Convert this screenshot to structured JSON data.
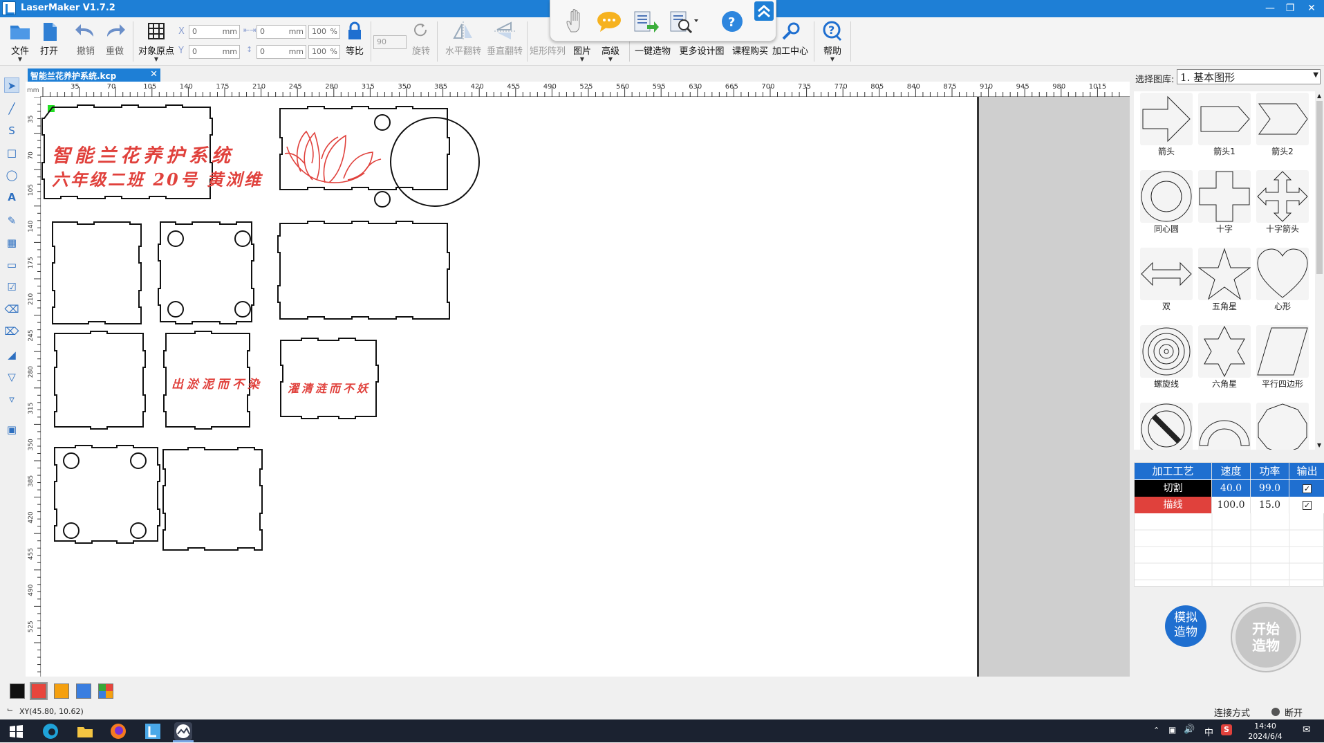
{
  "window": {
    "title": "LaserMaker V1.7.2"
  },
  "toolbar": {
    "file": "文件",
    "open": "打开",
    "undo": "撤销",
    "redo": "重做",
    "origin": "对象原点",
    "x_label": "X",
    "y_label": "Y",
    "x_value": "0",
    "y_value": "0",
    "w_value": "0",
    "h_value": "0",
    "unit_mm": "mm",
    "w_scale": "100",
    "h_scale": "100",
    "pct": "%",
    "proportional": "等比",
    "angle_value": "90",
    "rotate": "旋转",
    "flip_h": "水平翻转",
    "flip_v": "垂直翻转",
    "rect_array": "矩形阵列",
    "image": "图片",
    "advanced": "高级",
    "one_click": "一键造物",
    "more_designs": "更多设计图",
    "course_buy": "课程购买",
    "processing_center": "加工中心",
    "help": "帮助"
  },
  "document": {
    "tab": "智能兰花养护系统.kcp"
  },
  "ruler": {
    "unit": "mm",
    "h_ticks": [
      "35",
      "70",
      "105",
      "140",
      "175",
      "210",
      "245",
      "280",
      "315",
      "350",
      "385",
      "420",
      "455",
      "490",
      "525",
      "560",
      "595",
      "630",
      "665",
      "700",
      "735",
      "770",
      "805",
      "840",
      "875",
      "910",
      "945",
      "980",
      "1015"
    ],
    "v_ticks": [
      "35",
      "70",
      "105",
      "140",
      "175",
      "210",
      "245",
      "280",
      "315",
      "350",
      "385",
      "420",
      "455",
      "490",
      "525"
    ]
  },
  "canvas_text": {
    "line1": "智能兰花养护系统",
    "line2": "六年级二班 20号 黄浏维",
    "motto1": "出淤泥而不染",
    "motto2": "濯清涟而不妖"
  },
  "library": {
    "label": "选择图库:",
    "selected": "1. 基本图形",
    "shapes": [
      "箭头",
      "箭头1",
      "箭头2",
      "同心圆",
      "十字",
      "十字箭头",
      "双",
      "五角星",
      "心形",
      "螺旋线",
      "六角星",
      "平行四边形"
    ]
  },
  "process": {
    "headers": [
      "加工工艺",
      "速度",
      "功率",
      "输出"
    ],
    "rows": [
      {
        "name": "切割",
        "speed": "40.0",
        "power": "99.0",
        "color": "#000000"
      },
      {
        "name": "描线",
        "speed": "100.0",
        "power": "15.0",
        "color": "#e0413c"
      }
    ]
  },
  "actions": {
    "simulate": "模拟造物",
    "start": "开始造物"
  },
  "palette": [
    "#111111",
    "#e8453c",
    "#f5a00f",
    "#3a7ee0"
  ],
  "status": {
    "coords": "XY(45.80, 10.62)",
    "connection_label": "连接方式",
    "connection_state": "断开"
  },
  "taskbar": {
    "time": "14:40",
    "date": "2024/6/4",
    "ime": "中"
  }
}
